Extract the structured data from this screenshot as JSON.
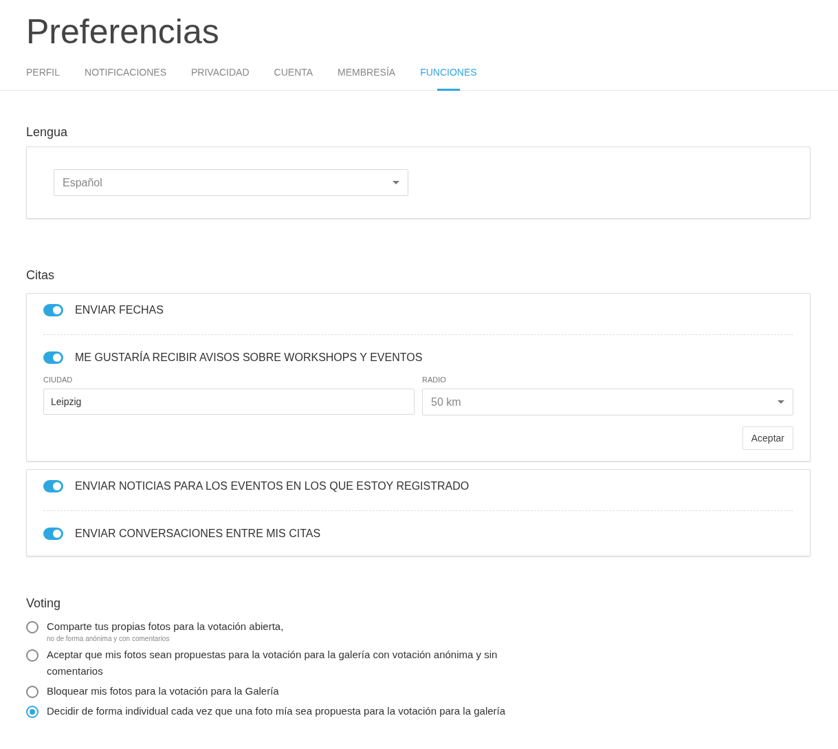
{
  "title": "Preferencias",
  "tabs": [
    {
      "label": "PERFIL",
      "selected": false
    },
    {
      "label": "NOTIFICACIONES",
      "selected": false
    },
    {
      "label": "PRIVACIDAD",
      "selected": false
    },
    {
      "label": "CUENTA",
      "selected": false
    },
    {
      "label": "MEMBRESÍA",
      "selected": false
    },
    {
      "label": "FUNCIONES",
      "selected": true
    }
  ],
  "language": {
    "heading": "Lengua",
    "select": {
      "value": "Español"
    }
  },
  "citas": {
    "heading": "Citas",
    "cards": [
      {
        "toggles": [
          {
            "label": "ENVIAR FECHAS",
            "on": true
          },
          {
            "label": "ME GUSTARÍA RECIBIR AVISOS SOBRE WORKSHOPS Y EVENTOS",
            "on": true
          }
        ],
        "location": {
          "city_label": "CIUDAD",
          "city_value": "Leipzig",
          "radius_label": "RADIO",
          "radius_value": "50 km",
          "button": "Aceptar"
        }
      },
      {
        "toggles": [
          {
            "label": "ENVIAR NOTICIAS PARA LOS EVENTOS EN LOS QUE ESTOY REGISTRADO",
            "on": true
          },
          {
            "label": "ENVIAR CONVERSACIONES ENTRE MIS CITAS",
            "on": true
          }
        ]
      }
    ]
  },
  "voting": {
    "heading": "Voting",
    "options": [
      {
        "label": "Comparte tus propias fotos para la votación abierta,",
        "note": "no de forma anónima y con comentarios",
        "selected": false
      },
      {
        "label": "Aceptar que mis fotos sean propuestas para la votación para la galería con votación anónima y sin comentarios",
        "selected": false
      },
      {
        "label": "Bloquear mis fotos para la votación para la Galería",
        "selected": false
      },
      {
        "label": "Decidir de forma individual cada vez que una foto mía sea propuesta para la votación para la galería",
        "selected": true
      }
    ]
  }
}
